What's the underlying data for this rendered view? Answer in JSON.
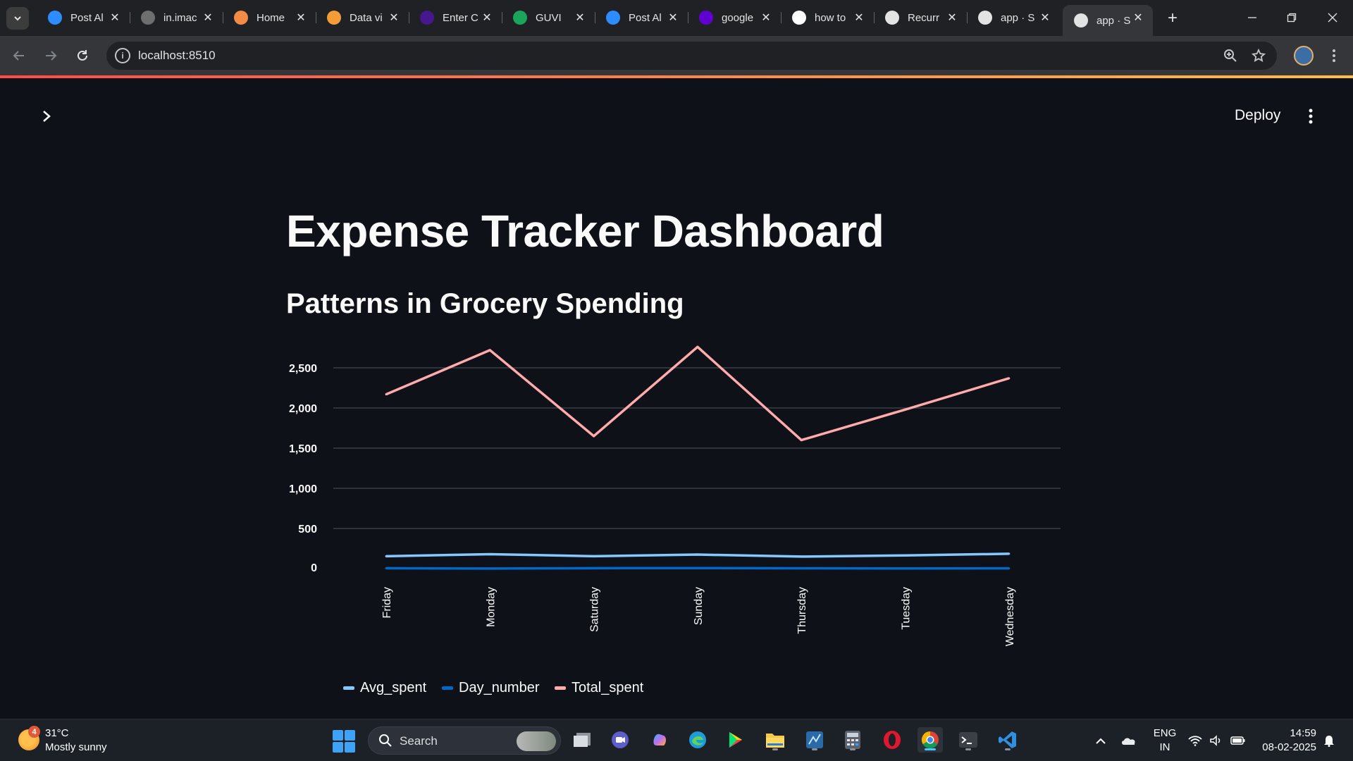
{
  "browser": {
    "tabs": [
      {
        "title": "Post Al",
        "favicon": "zoom-icon",
        "color": "#2d8cff"
      },
      {
        "title": "in.imac",
        "favicon": "yahoo-y-icon",
        "color": "#6e6e6e"
      },
      {
        "title": "Home",
        "favicon": "loader-ring-icon",
        "color": "#f28b45"
      },
      {
        "title": "Data vi",
        "favicon": "book-icon",
        "color": "#f29d38"
      },
      {
        "title": "Enter C",
        "favicon": "kahoot-icon",
        "color": "#46178f"
      },
      {
        "title": "GUVI",
        "favicon": "guvi-icon",
        "color": "#1aa55a"
      },
      {
        "title": "Post Al",
        "favicon": "zoom-icon",
        "color": "#2d8cff"
      },
      {
        "title": "google",
        "favicon": "yahoo-icon",
        "color": "#6001d2"
      },
      {
        "title": "how to",
        "favicon": "google-icon",
        "color": "#ffffff"
      },
      {
        "title": "Recurr",
        "favicon": "openai-icon",
        "color": "#e3e3e3"
      },
      {
        "title": "app · S",
        "favicon": "streamlit-crown-icon",
        "color": "#e3e3e3"
      },
      {
        "title": "app · S",
        "favicon": "streamlit-crown-icon",
        "color": "#e3e3e3",
        "active": true
      }
    ],
    "url": "localhost:8510"
  },
  "app": {
    "deploy_label": "Deploy",
    "title": "Expense Tracker Dashboard",
    "subtitle": "Patterns in Grocery Spending"
  },
  "chart_data": {
    "type": "line",
    "categories": [
      "Friday",
      "Monday",
      "Saturday",
      "Sunday",
      "Thursday",
      "Tuesday",
      "Wednesday"
    ],
    "series": [
      {
        "name": "Avg_spent",
        "color": "#83c9ff",
        "values": [
          155,
          180,
          155,
          175,
          150,
          165,
          185
        ]
      },
      {
        "name": "Day_number",
        "color": "#0068c9",
        "values": [
          5,
          1,
          6,
          7,
          4,
          2,
          3
        ]
      },
      {
        "name": "Total_spent",
        "color": "#ffabab",
        "values": [
          2170,
          2720,
          1650,
          2760,
          1600,
          1980,
          2370
        ]
      }
    ],
    "y_ticks": [
      "0",
      "500",
      "1,000",
      "1,500",
      "2,000",
      "2,500"
    ],
    "y_tick_values": [
      0,
      500,
      1000,
      1500,
      2000,
      2500
    ],
    "ylim": [
      0,
      2500
    ],
    "grid": true,
    "legend_position": "bottom"
  },
  "taskbar": {
    "weather": {
      "temp": "31°C",
      "desc": "Mostly sunny",
      "badge": "4"
    },
    "search_label": "Search",
    "lang_line1": "ENG",
    "lang_line2": "IN",
    "time": "14:59",
    "date": "08-02-2025"
  }
}
